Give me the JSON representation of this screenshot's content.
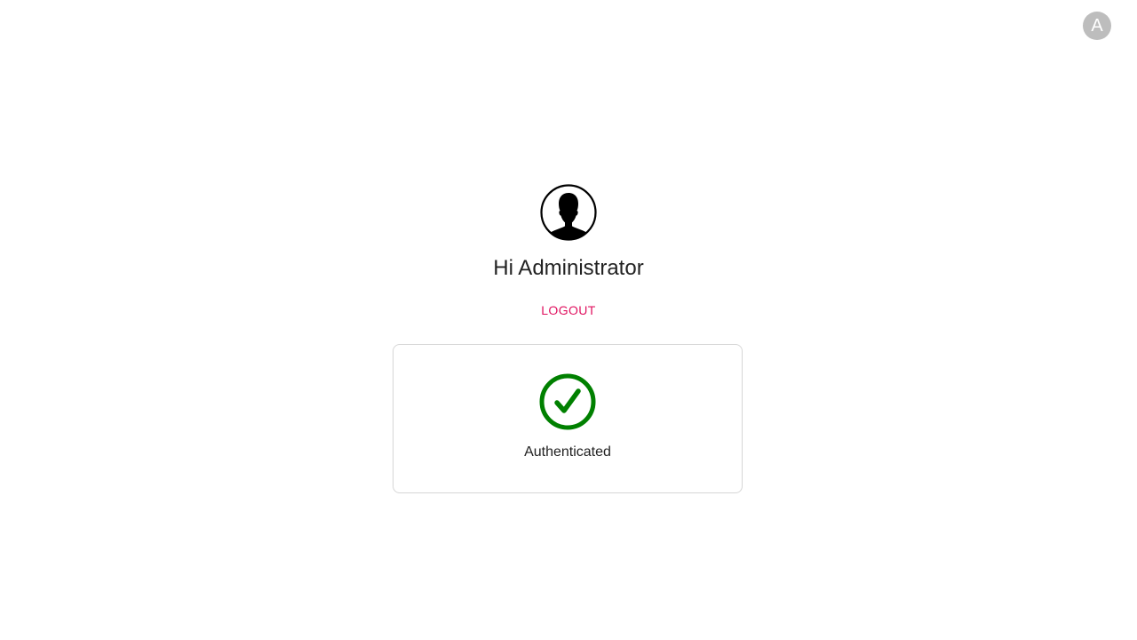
{
  "header": {
    "avatar_initial": "A"
  },
  "profile": {
    "icon": "user-silhouette-icon",
    "greeting": "Hi Administrator",
    "logout_label": "LOGOUT"
  },
  "status": {
    "icon": "check-circle-icon",
    "label": "Authenticated"
  },
  "colors": {
    "accent": "#e0115f",
    "success": "#008000",
    "avatar_bg": "#bdbdbd",
    "card_border": "#d6d6d6"
  }
}
